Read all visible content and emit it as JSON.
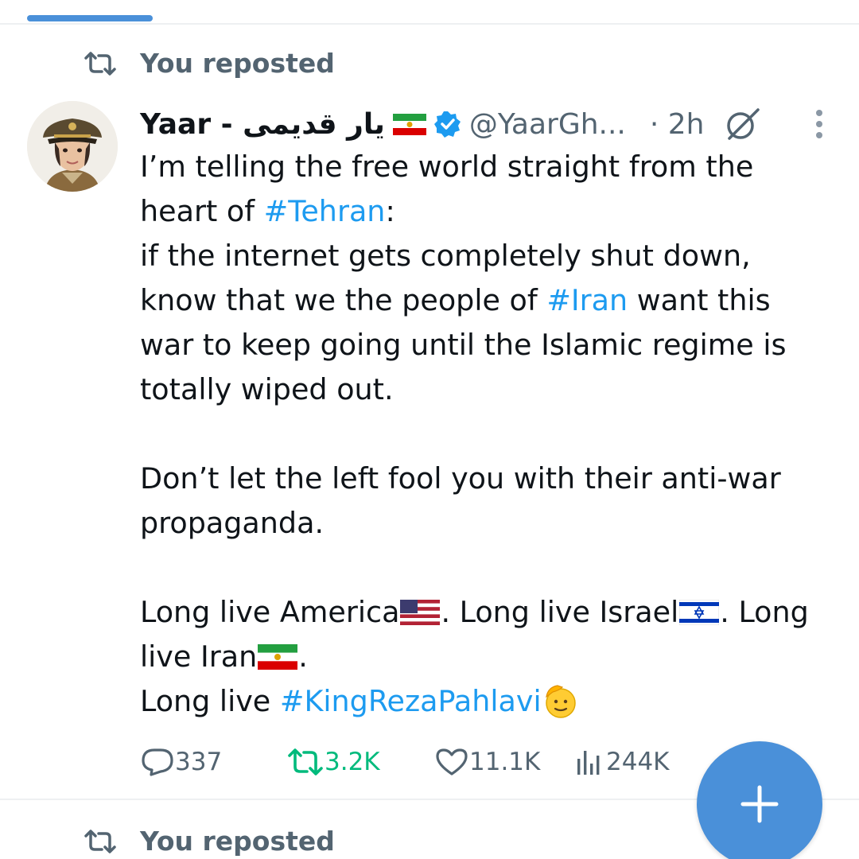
{
  "reposts": {
    "first_label": "You reposted",
    "second_label": "You reposted"
  },
  "tweet": {
    "display_name": "Yaar - یار قدیمی",
    "handle": "@YaarGh...",
    "time": "· 2h",
    "lines": {
      "l1": "I’m telling the free world straight from the",
      "l2_pre": "heart of ",
      "l2_tag": "#Tehran",
      "l2_post": ":",
      "l3": "if the internet gets completely shut down,",
      "l4_pre": "know that we the people of ",
      "l4_tag": "#Iran",
      "l4_post": " want this",
      "l5": "war to keep going until the Islamic regime is",
      "l6": "totally wiped out.",
      "l7": "Don’t let the left fool you with their anti-war",
      "l8": "propaganda.",
      "l9_a": "Long live America",
      "l9_b": ". Long live Israel",
      "l9_c": ". Long",
      "l10_a": "live Iran",
      "l10_b": ".",
      "l11_pre": "Long live ",
      "l11_tag": "#KingRezaPahlavi"
    },
    "emojis": [
      "flag-iran-lion-sun",
      "flag-usa",
      "flag-israel",
      "flag-iran-lion-sun",
      "saluting-face"
    ]
  },
  "actions": {
    "replies": "337",
    "reposts": "3.2K",
    "likes": "11.1K",
    "views": "244K"
  },
  "icons": {
    "repost": "repost-icon",
    "verified": "verified-badge-icon",
    "grok": "grok-icon",
    "more": "more-vertical-icon",
    "reply": "reply-icon",
    "like": "heart-icon",
    "views": "views-icon",
    "compose": "plus-icon"
  },
  "colors": {
    "link": "#1d9bf0",
    "retweeted": "#00ba7c",
    "muted": "#536471",
    "fab": "#4a90d9"
  }
}
